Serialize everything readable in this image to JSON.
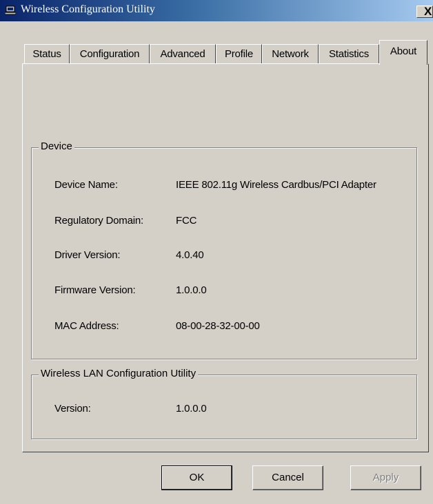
{
  "window": {
    "title": "Wireless Configuration Utility",
    "close_glyph": "X"
  },
  "tabs": [
    {
      "label": "Status"
    },
    {
      "label": "Configuration"
    },
    {
      "label": "Advanced"
    },
    {
      "label": "Profile"
    },
    {
      "label": "Network"
    },
    {
      "label": "Statistics"
    },
    {
      "label": "About",
      "active": true
    }
  ],
  "device": {
    "group_title": "Device",
    "fields": [
      {
        "label": "Device Name:",
        "value": "IEEE 802.11g Wireless Cardbus/PCI Adapter"
      },
      {
        "label": "Regulatory Domain:",
        "value": "FCC"
      },
      {
        "label": "Driver Version:",
        "value": "4.0.40"
      },
      {
        "label": "Firmware Version:",
        "value": "1.0.0.0"
      },
      {
        "label": "MAC Address:",
        "value": "08-00-28-32-00-00"
      }
    ]
  },
  "utility": {
    "group_title": "Wireless LAN Configuration Utility",
    "version_label": "Version:",
    "version_value": "1.0.0.0"
  },
  "buttons": {
    "ok": "OK",
    "cancel": "Cancel",
    "apply": "Apply"
  }
}
